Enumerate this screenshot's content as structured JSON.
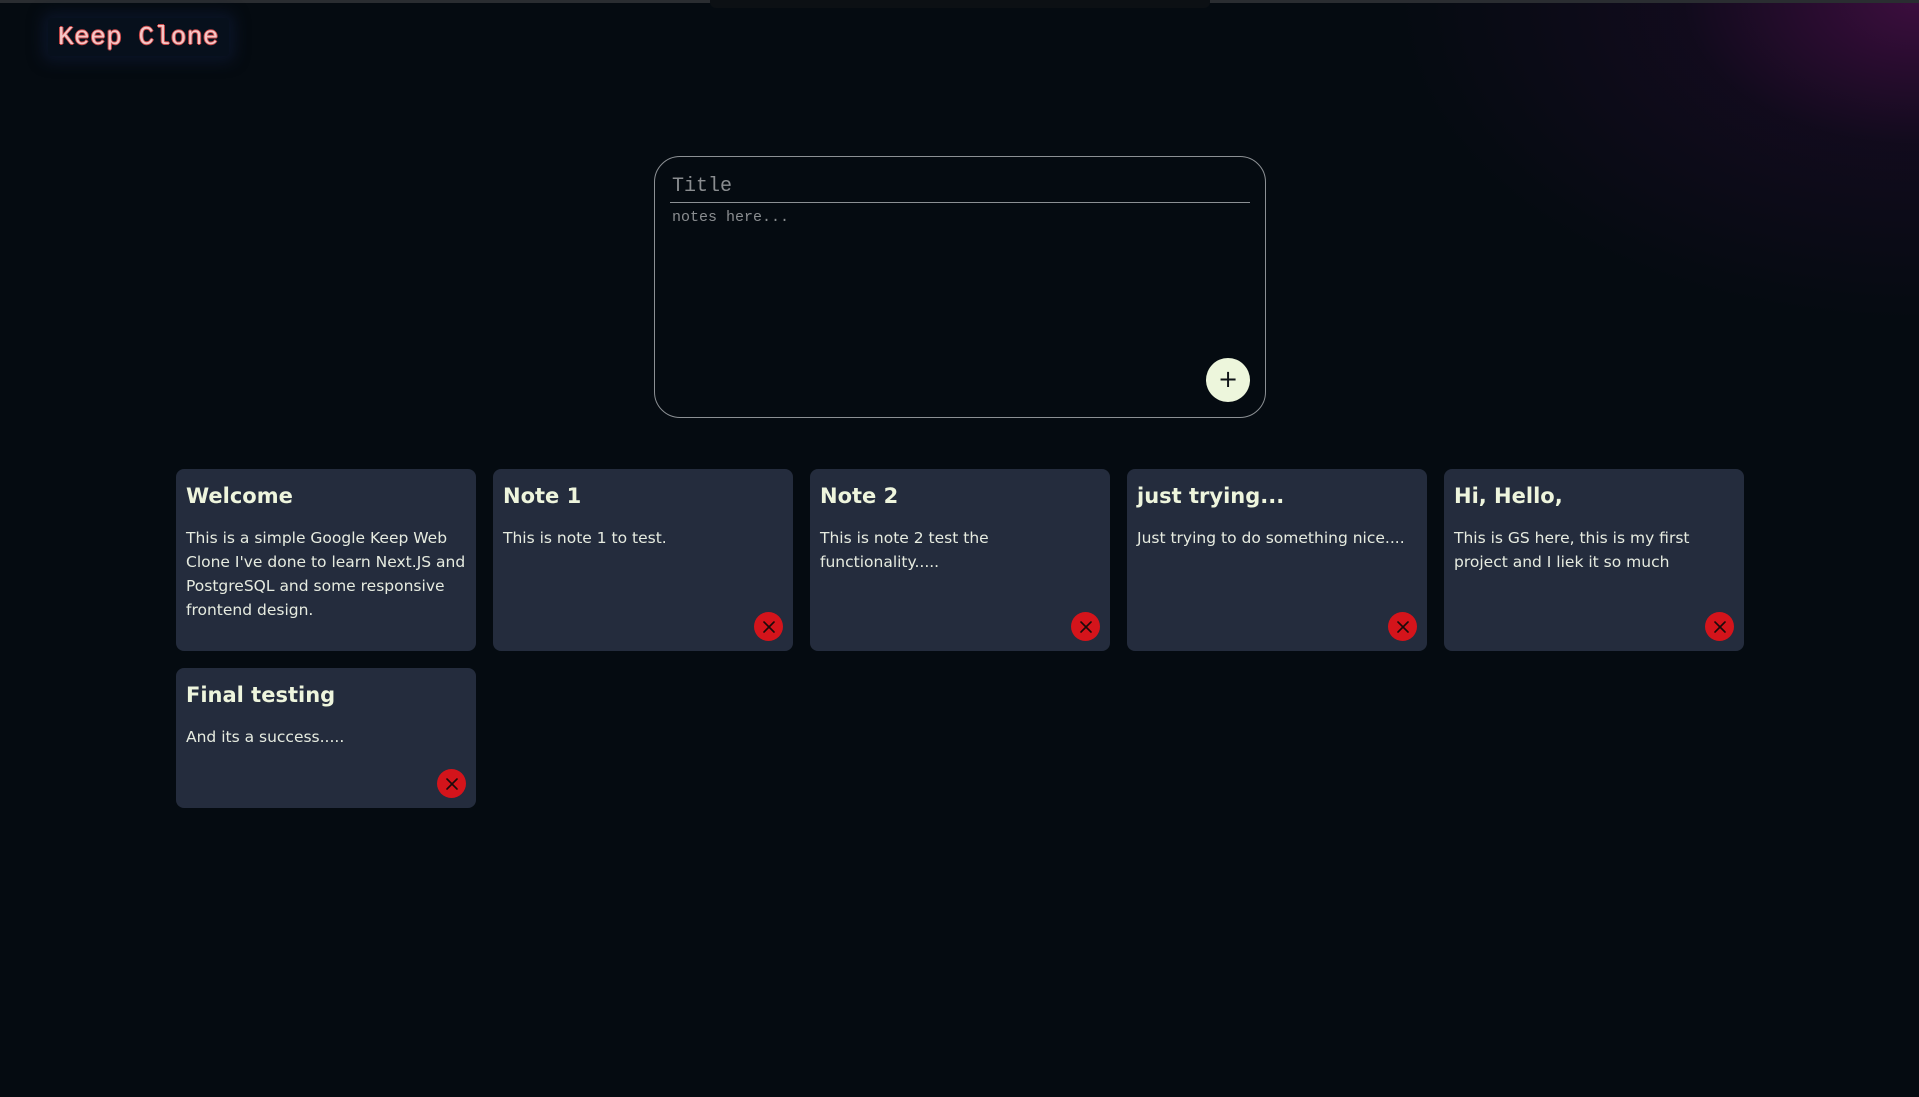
{
  "app": {
    "title": "Keep Clone"
  },
  "composer": {
    "title_placeholder": "Title",
    "notes_placeholder": "notes here...",
    "title_value": "",
    "notes_value": "",
    "add_icon": "plus-icon",
    "add_label": "+"
  },
  "notes": [
    {
      "title": "Welcome",
      "body": "This is a simple Google Keep Web Clone I've done to learn Next.JS and PostgreSQL and some responsive frontend design."
    },
    {
      "title": "Note 1",
      "body": "This is note 1 to test."
    },
    {
      "title": "Note 2",
      "body": "This is note 2 test the functionality....."
    },
    {
      "title": "just trying...",
      "body": "Just trying to do something nice...."
    },
    {
      "title": "Hi, Hello,",
      "body": "This is GS here, this is my first project and I liek it so much"
    },
    {
      "title": "Final testing",
      "body": "And its a success....."
    }
  ],
  "colors": {
    "background": "#050b11",
    "card": "#242c3d",
    "title_text": "#eef5dd",
    "delete_button": "#d4141b",
    "add_button": "#edf6dc",
    "logo_text": "#f4c7c7"
  },
  "icons": {
    "delete": "close-icon",
    "add": "plus-icon"
  }
}
